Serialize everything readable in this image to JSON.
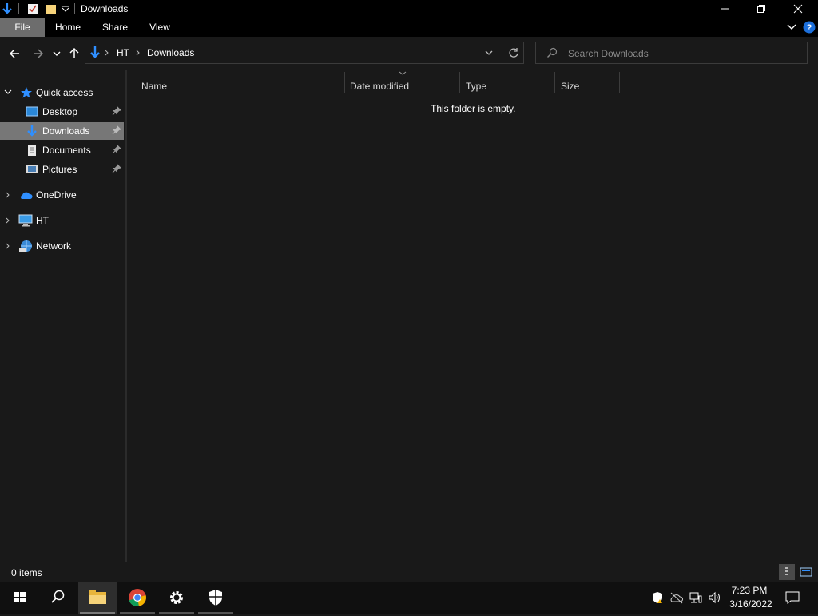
{
  "window": {
    "title": "Downloads"
  },
  "ribbon": {
    "tabs": [
      "File",
      "Home",
      "Share",
      "View"
    ]
  },
  "address": {
    "crumbs": [
      "HT",
      "Downloads"
    ],
    "search_placeholder": "Search Downloads"
  },
  "nav": {
    "quick_access": "Quick access",
    "pinned": [
      {
        "label": "Desktop",
        "icon": "desktop-icon"
      },
      {
        "label": "Downloads",
        "icon": "download-icon"
      },
      {
        "label": "Documents",
        "icon": "documents-icon"
      },
      {
        "label": "Pictures",
        "icon": "pictures-icon"
      }
    ],
    "selected": "Downloads",
    "roots": [
      {
        "label": "OneDrive",
        "icon": "onedrive-icon"
      },
      {
        "label": "HT",
        "icon": "computer-icon"
      },
      {
        "label": "Network",
        "icon": "network-icon"
      }
    ]
  },
  "content": {
    "columns": [
      "Name",
      "Date modified",
      "Type",
      "Size"
    ],
    "empty_message": "This folder is empty."
  },
  "status": {
    "item_count": "0 items"
  },
  "taskbar": {
    "time": "7:23 PM",
    "date": "3/16/2022"
  },
  "colors": {
    "background": "#191919",
    "selection": "#777777",
    "accent": "#1e90ff"
  }
}
